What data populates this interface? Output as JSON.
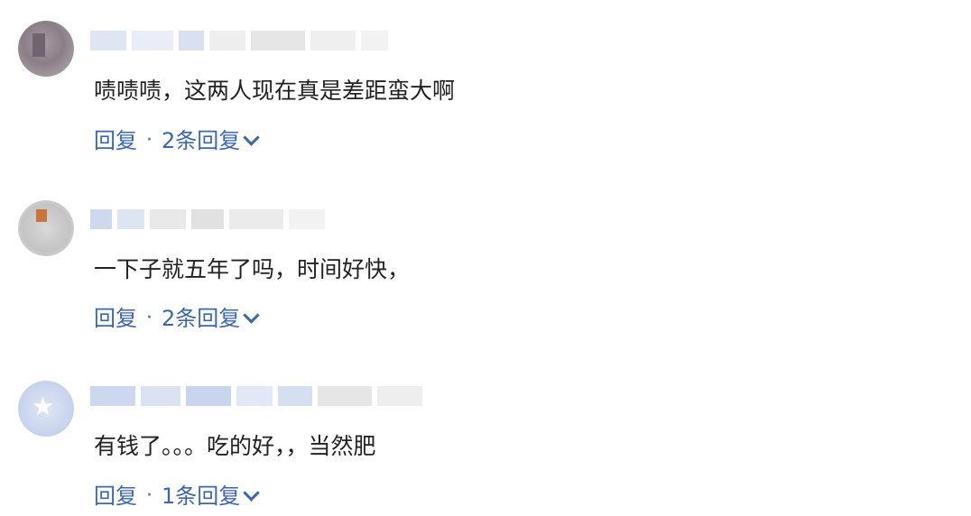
{
  "comments": [
    {
      "text": "啧啧啧，这两人现在真是差距蛮大啊",
      "reply_label": "回复",
      "separator": "·",
      "replies_label": "2条回复"
    },
    {
      "text": "一下子就五年了吗，时间好快，",
      "reply_label": "回复",
      "separator": "·",
      "replies_label": "2条回复"
    },
    {
      "text": "有钱了。。。吃的好，，当然肥",
      "reply_label": "回复",
      "separator": "·",
      "replies_label": "1条回复"
    }
  ],
  "icons": {
    "expand": "chevron-down-icon"
  },
  "colors": {
    "link": "#3c67ae",
    "text": "#222222",
    "background": "#ffffff"
  }
}
